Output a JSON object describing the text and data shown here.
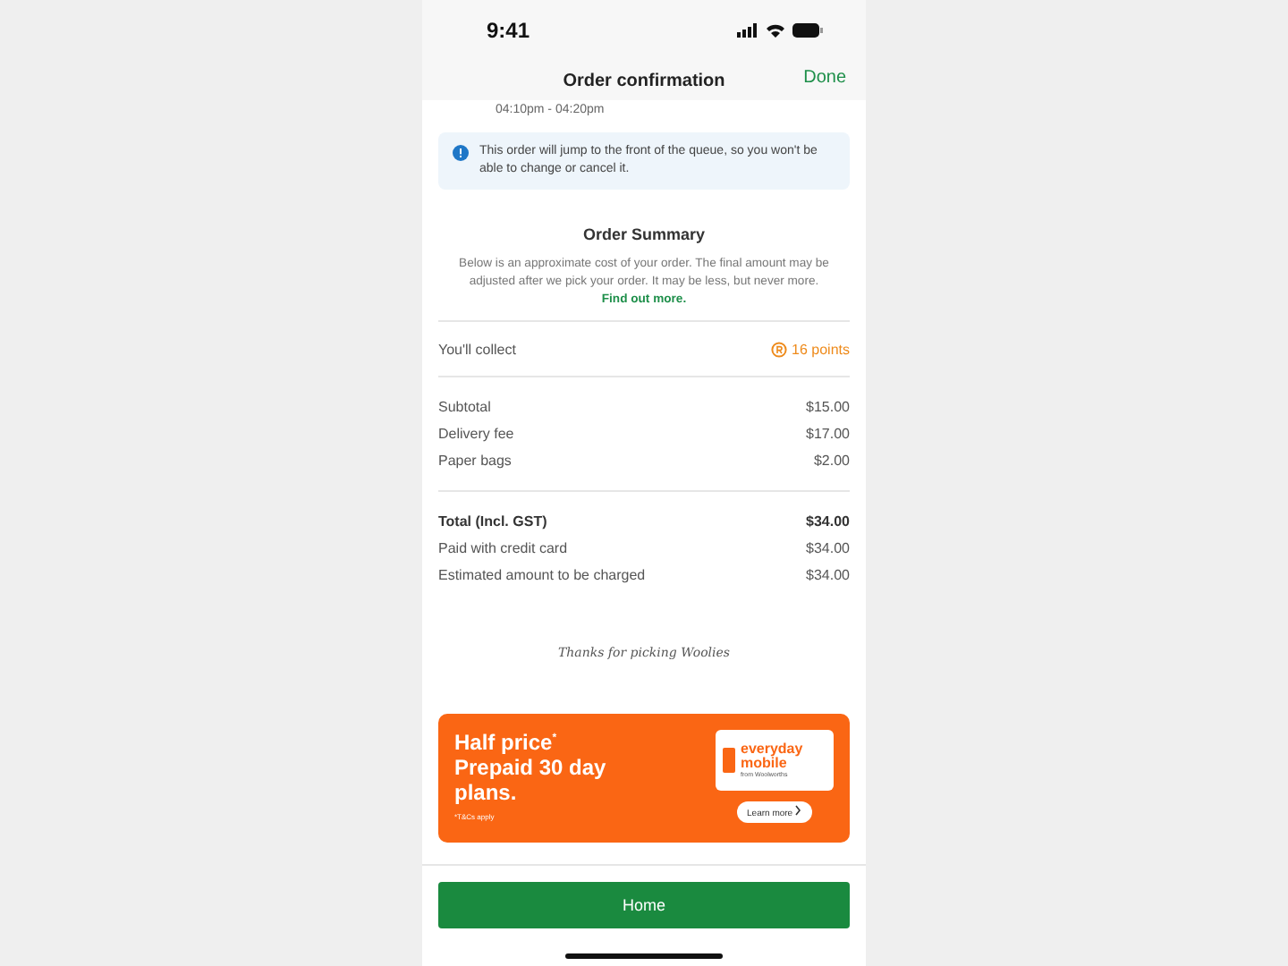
{
  "status_bar": {
    "time": "9:41"
  },
  "nav": {
    "title": "Order confirmation",
    "action": "Done"
  },
  "time_slot": "04:10pm - 04:20pm",
  "notice": "This order will jump to the front of the queue, so you won't be able to change or cancel it.",
  "summary": {
    "title": "Order Summary",
    "description": "Below is an approximate cost of your order. The final amount may be adjusted after we pick your order. It may be less, but never more.",
    "link": "Find out more."
  },
  "rewards": {
    "label": "You'll collect",
    "points": "16 points"
  },
  "charges": [
    {
      "label": "Subtotal",
      "amount": "$15.00"
    },
    {
      "label": "Delivery fee",
      "amount": "$17.00"
    },
    {
      "label": "Paper bags",
      "amount": "$2.00"
    }
  ],
  "totals": [
    {
      "label": "Total (Incl. GST)",
      "amount": "$34.00",
      "bold": true
    },
    {
      "label": "Paid with credit card",
      "amount": "$34.00",
      "bold": false
    },
    {
      "label": "Estimated amount to be charged",
      "amount": "$34.00",
      "bold": false
    }
  ],
  "thanks": "Thanks for picking Woolies",
  "promo": {
    "headline": "Half price$^{*}$",
    "subline": "Prepaid 30 day plans.",
    "terms": "*T&Cs apply",
    "logo_line1": "everyday",
    "logo_line2": "mobile",
    "logo_tagline": "from Woolworths",
    "cta": "Learn more"
  },
  "home_button": "Home"
}
